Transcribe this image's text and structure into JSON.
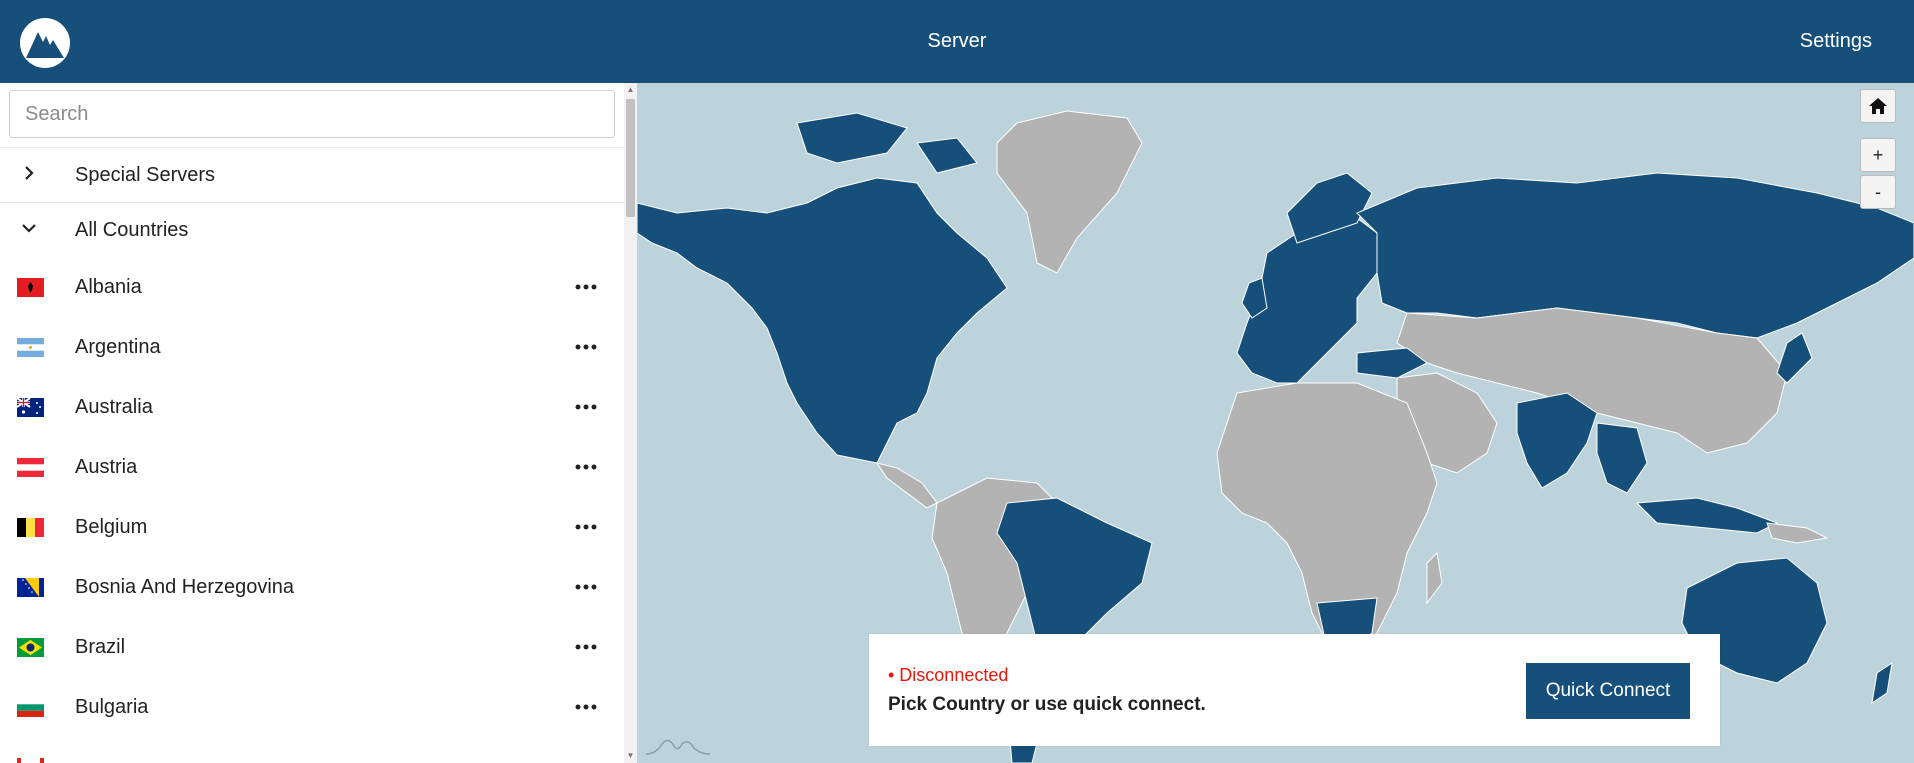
{
  "header": {
    "title": "Server",
    "settings_label": "Settings",
    "logo_icon": "mountain-logo-icon"
  },
  "search": {
    "placeholder": "Search",
    "value": ""
  },
  "groups": [
    {
      "label": "Special Servers",
      "icon": "chevron-right-icon"
    },
    {
      "label": "All Countries",
      "icon": "chevron-down-icon"
    }
  ],
  "countries": [
    {
      "label": "Albania"
    },
    {
      "label": "Argentina"
    },
    {
      "label": "Australia"
    },
    {
      "label": "Austria"
    },
    {
      "label": "Belgium"
    },
    {
      "label": "Bosnia And Herzegovina"
    },
    {
      "label": "Brazil"
    },
    {
      "label": "Bulgaria"
    }
  ],
  "map": {
    "home_icon": "home-icon",
    "zoom_in_label": "+",
    "zoom_out_label": "-",
    "colors": {
      "ocean": "#bcd3db",
      "available": "#16507a",
      "unavailable": "#b3b3b3"
    }
  },
  "status": {
    "state": "• Disconnected",
    "message": "Pick Country or use quick connect.",
    "quick_connect_label": "Quick Connect",
    "state_color": "#e8170b"
  },
  "colors": {
    "brand": "#16507a"
  }
}
